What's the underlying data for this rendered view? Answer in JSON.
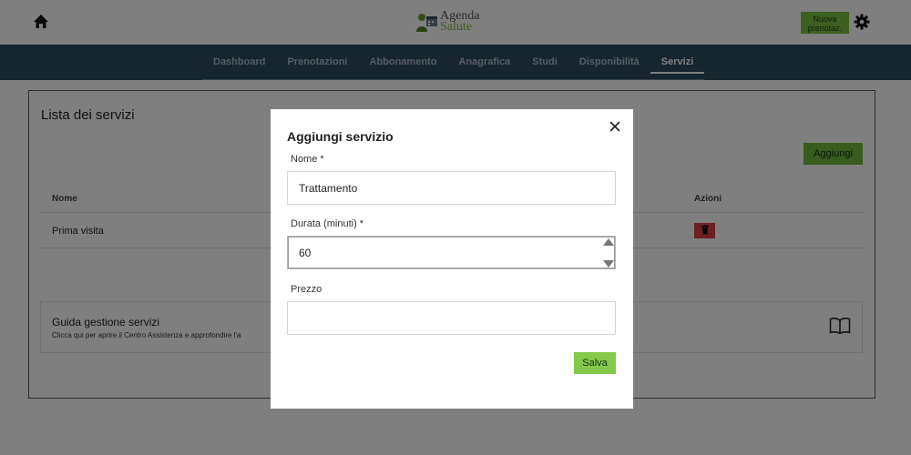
{
  "header": {
    "logo_line1": "Agenda",
    "logo_line2": "Salute",
    "new_booking_line1": "Nuova",
    "new_booking_line2": "prenotaz."
  },
  "nav": {
    "items": [
      "Dashboard",
      "Prenotazioni",
      "Abbonamento",
      "Anagrafica",
      "Studi",
      "Disponibilità",
      "Servizi"
    ],
    "active": "Servizi"
  },
  "page": {
    "title": "Lista dei servizi",
    "add_label": "Aggiungi",
    "columns": {
      "name": "Nome",
      "actions": "Azioni"
    },
    "rows": [
      {
        "name": "Prima visita"
      }
    ],
    "guide": {
      "title": "Guida gestione servizi",
      "description": "Clicca qui per aprire il Centro Assistenza e approfondire l'a"
    }
  },
  "modal": {
    "title": "Aggiungi servizio",
    "name_label": "Nome *",
    "name_value": "Trattamento",
    "duration_label": "Durata (minuti) *",
    "duration_value": "60",
    "price_label": "Prezzo",
    "price_value": "",
    "save_label": "Salva"
  },
  "colors": {
    "nav_bg": "#2f4a5e",
    "accent_green": "#7bc143",
    "delete_red": "#d9414b"
  }
}
